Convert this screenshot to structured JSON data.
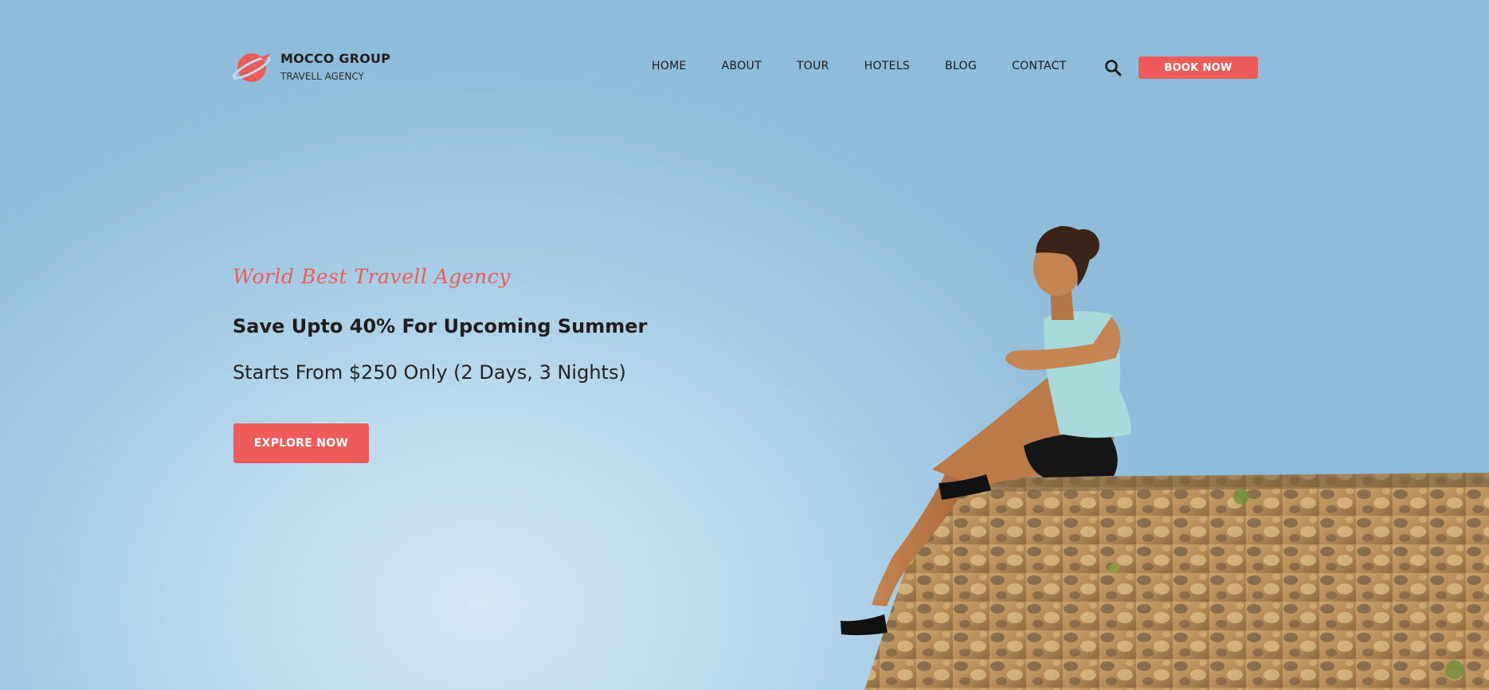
{
  "brand": {
    "name": "MOCCO GROUP",
    "tagline": "TRAVELL AGENCY",
    "logo_icon": "planet-plane-icon",
    "accent_color": "#ef5b5b"
  },
  "nav": {
    "items": [
      {
        "label": "HOME"
      },
      {
        "label": "ABOUT"
      },
      {
        "label": "TOUR"
      },
      {
        "label": "HOTELS"
      },
      {
        "label": "BLOG"
      },
      {
        "label": "CONTACT"
      }
    ],
    "search_icon": "search-icon",
    "cta_label": "BOOK NOW"
  },
  "hero": {
    "tagline": "World Best Travell Agency",
    "title": "Save Upto 40% For Upcoming Summer",
    "subtitle": "Starts From $250 Only (2 Days, 3 Nights)",
    "button_label": "EXPLORE NOW",
    "image": "woman-sitting-on-stone-wall-illustration"
  }
}
